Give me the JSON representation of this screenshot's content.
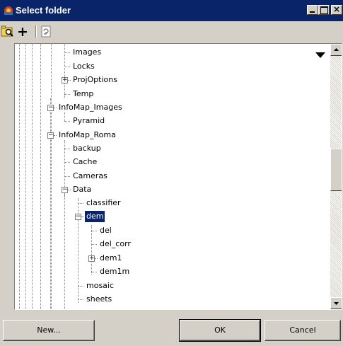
{
  "window": {
    "title": "Select folder",
    "title_bar_color": "#0a246a"
  },
  "toolbar": {
    "search_icon": "folder-search-icon",
    "add_label": "+",
    "refresh_icon": "refresh-icon"
  },
  "tree": {
    "rows": [
      {
        "label": "Images",
        "expander": ""
      },
      {
        "label": "Locks",
        "expander": ""
      },
      {
        "label": "ProjOptions",
        "expander": "+"
      },
      {
        "label": "Temp",
        "expander": ""
      },
      {
        "label": "InfoMap_Images",
        "expander": "−"
      },
      {
        "label": "Pyramid",
        "expander": ""
      },
      {
        "label": "InfoMap_Roma",
        "expander": "−"
      },
      {
        "label": "backup",
        "expander": ""
      },
      {
        "label": "Cache",
        "expander": ""
      },
      {
        "label": "Cameras",
        "expander": ""
      },
      {
        "label": "Data",
        "expander": "−"
      },
      {
        "label": "classifier",
        "expander": ""
      },
      {
        "label": "dem",
        "expander": "−"
      },
      {
        "label": "del",
        "expander": ""
      },
      {
        "label": "del_corr",
        "expander": ""
      },
      {
        "label": "dem1",
        "expander": "+"
      },
      {
        "label": "dem1m",
        "expander": ""
      },
      {
        "label": "mosaic",
        "expander": ""
      },
      {
        "label": "sheets",
        "expander": ""
      }
    ],
    "selected": "dem",
    "selection_color": "#0a246a"
  },
  "buttons": {
    "new": "New...",
    "ok": "OK",
    "cancel": "Cancel"
  }
}
